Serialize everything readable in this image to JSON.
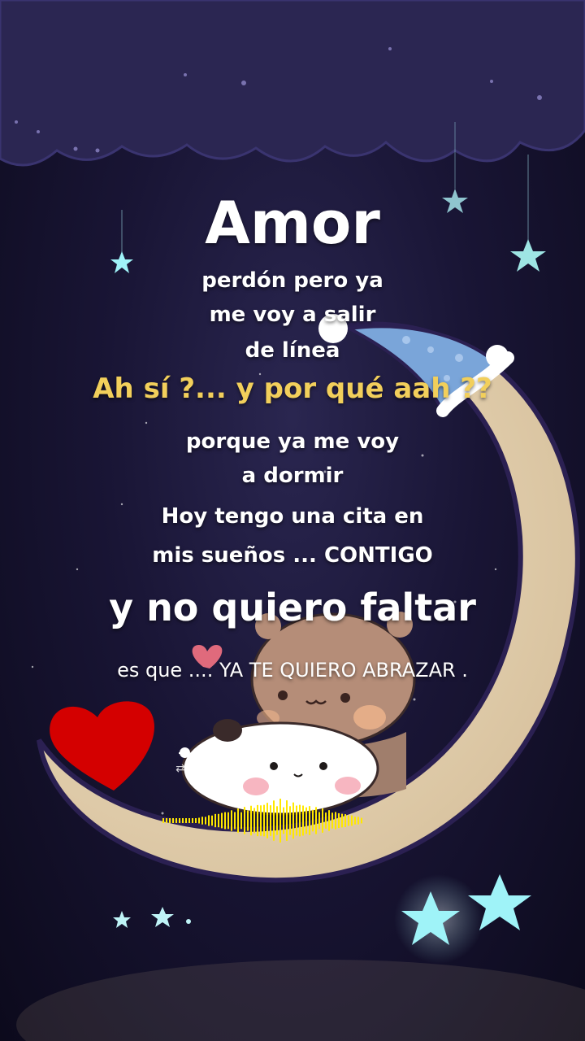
{
  "lines": {
    "title": "Amor",
    "line1": "perdón pero ya",
    "line2": "me voy a salir",
    "line3": "de línea",
    "question": "Ah sí ?...  y por qué aah ??",
    "line4": "porque ya me voy",
    "line5": "a dormir",
    "line6": "Hoy tengo una cita en",
    "line7": "mis sueños ... CONTIGO",
    "big_line": "y no quiero faltar",
    "last_line": "es que .... YA TE QUIERO ABRAZAR ."
  },
  "player": {
    "progress": 0.03,
    "controls": [
      "shuffle-icon",
      "previous-icon",
      "pause-icon",
      "next-icon",
      "repeat-icon"
    ]
  },
  "colors": {
    "text_white": "#ffffff",
    "text_yellow": "#f2cf5b",
    "heart_red": "#d40000",
    "moon": "#e3cfae",
    "waveform": "#ffe800",
    "star_glow": "#9ff3f8"
  }
}
